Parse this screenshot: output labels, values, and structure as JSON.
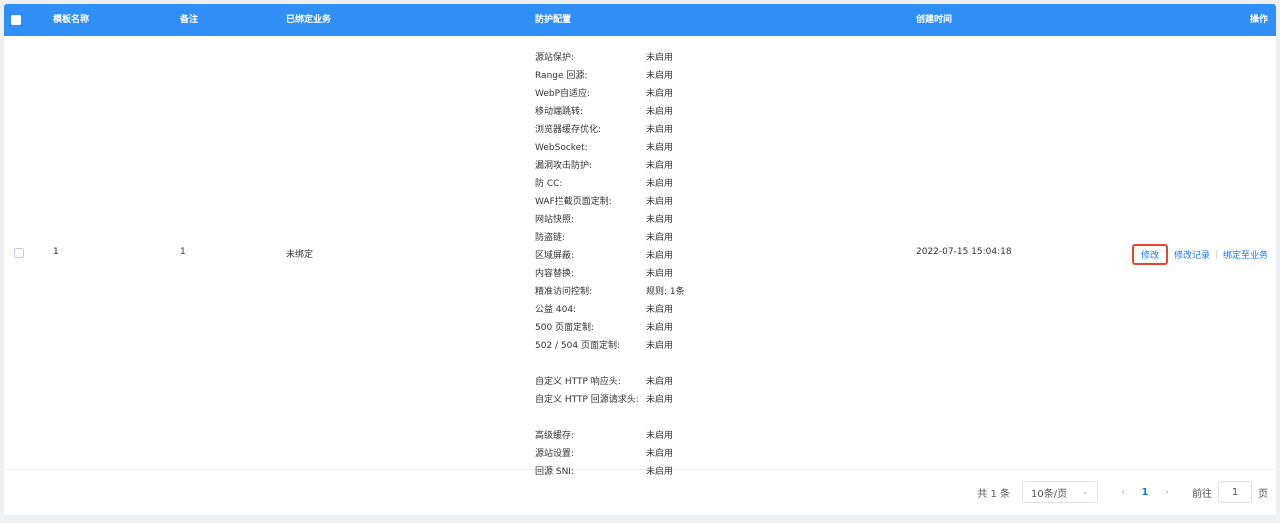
{
  "table": {
    "headers": {
      "name": "模板名称",
      "remark": "备注",
      "bound": "已绑定业务",
      "protect": "防护配置",
      "created": "创建时间",
      "ops": "操作"
    },
    "row": {
      "name": "1",
      "remark": "1",
      "bound": "未绑定",
      "created": "2022-07-15 15:04:18",
      "protect": [
        {
          "label": "源站保护:",
          "value": "未启用"
        },
        {
          "label": "Range 回源:",
          "value": "未启用"
        },
        {
          "label": "WebP自适应:",
          "value": "未启用"
        },
        {
          "label": "移动端跳转:",
          "value": "未启用"
        },
        {
          "label": "浏览器缓存优化:",
          "value": "未启用"
        },
        {
          "label": "WebSocket:",
          "value": "未启用"
        },
        {
          "label": "漏洞攻击防护:",
          "value": "未启用"
        },
        {
          "label": "防 CC:",
          "value": "未启用"
        },
        {
          "label": "WAF拦截页面定制:",
          "value": "未启用"
        },
        {
          "label": "网站快照:",
          "value": "未启用"
        },
        {
          "label": "防盗链:",
          "value": "未启用"
        },
        {
          "label": "区域屏蔽:",
          "value": "未启用"
        },
        {
          "label": "内容替换:",
          "value": "未启用"
        },
        {
          "label": "精准访问控制:",
          "value": "规则: 1条"
        },
        {
          "label": "公益 404:",
          "value": "未启用"
        },
        {
          "label": "500 页面定制:",
          "value": "未启用"
        },
        {
          "label": "502 / 504 页面定制:",
          "value": "未启用"
        },
        {
          "label": "自定义 HTTP 响应头:",
          "value": "未启用"
        },
        {
          "label": "自定义 HTTP 回源请求头:",
          "value": "未启用"
        },
        {
          "label": "高级缓存:",
          "value": "未启用"
        },
        {
          "label": "源站设置:",
          "value": "未启用"
        },
        {
          "label": "回源 SNI:",
          "value": "未启用"
        }
      ],
      "actions": {
        "edit": "修改",
        "history": "修改记录",
        "bind": "绑定至业务"
      }
    }
  },
  "pagination": {
    "total": "共 1 条",
    "page_size": "10条/页",
    "current": "1",
    "jump_label": "前往",
    "jump_value": "1",
    "page_unit": "页"
  }
}
